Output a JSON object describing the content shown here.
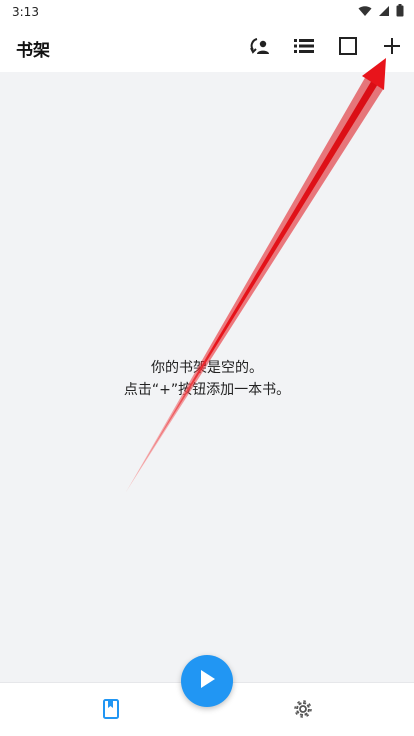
{
  "status_bar": {
    "time": "3:13",
    "icons": [
      "wifi-icon",
      "signal-icon",
      "battery-icon"
    ]
  },
  "app_bar": {
    "title": "书架",
    "actions": [
      "refresh-user-icon",
      "list-view-icon",
      "select-square-icon",
      "add-icon"
    ]
  },
  "empty_state": {
    "line1": "你的书架是空的。",
    "line2": "点击“+”按钮添加一本书。"
  },
  "bottom_nav": {
    "items": [
      "bookshelf-icon",
      "settings-icon"
    ],
    "fab": "play-icon",
    "accent": "#2196f3"
  },
  "annotation": {
    "color": "#e8141b",
    "points_to": "add-button"
  }
}
